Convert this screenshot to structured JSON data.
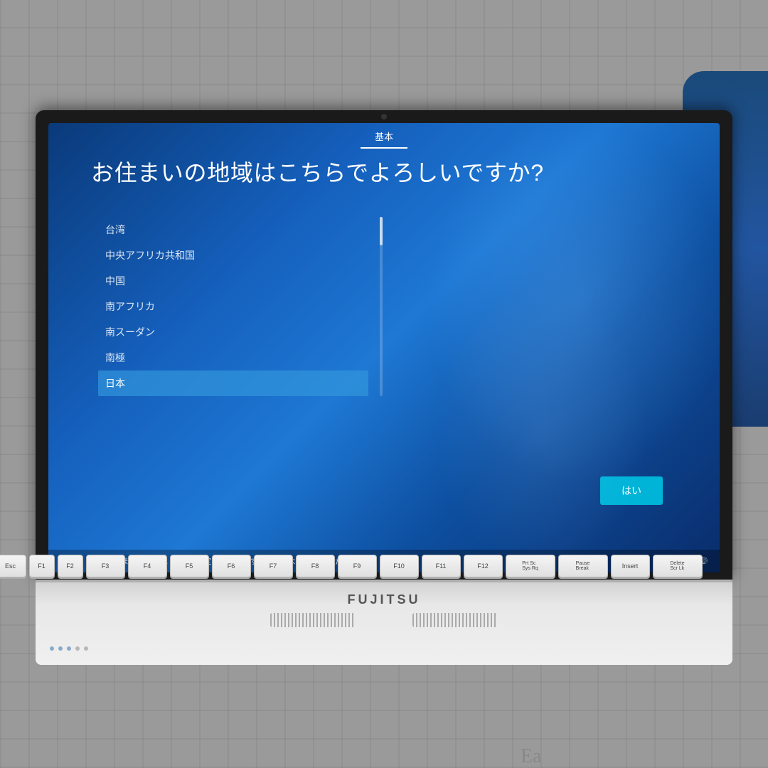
{
  "wall": {
    "bg_color": "#9a9898"
  },
  "screen": {
    "tab_label": "基本",
    "question": "お住まいの地域はこちらでよろしいですか?",
    "list_items": [
      {
        "id": 1,
        "label": "台湾",
        "selected": false
      },
      {
        "id": 2,
        "label": "中央アフリカ共和国",
        "selected": false
      },
      {
        "id": 3,
        "label": "中国",
        "selected": false
      },
      {
        "id": 4,
        "label": "南アフリカ",
        "selected": false
      },
      {
        "id": 5,
        "label": "南スーダン",
        "selected": false
      },
      {
        "id": 6,
        "label": "南極",
        "selected": false
      },
      {
        "id": 7,
        "label": "日本",
        "selected": true
      }
    ],
    "yes_button_label": "はい",
    "status_text": "お住まいの地域は 日本 に設定されています。これでよろしいですか?",
    "status_icon_power": "⏻",
    "status_icon_mic": "🎤",
    "status_icon_circle": "○",
    "status_icon_volume": "🔊"
  },
  "laptop": {
    "brand": "FUJITSU"
  },
  "keyboard": {
    "rows": [
      [
        "Esc",
        "F1",
        "F2",
        "F3",
        "F4",
        "F5",
        "F6",
        "F7",
        "F8",
        "F9",
        "F10",
        "F11",
        "F12",
        "Prt Sc\nSys Rq",
        "Pause\nBreak",
        "Insert",
        "Delete\nScr Lk"
      ]
    ]
  },
  "bottom_text": {
    "ea": "Ea"
  }
}
